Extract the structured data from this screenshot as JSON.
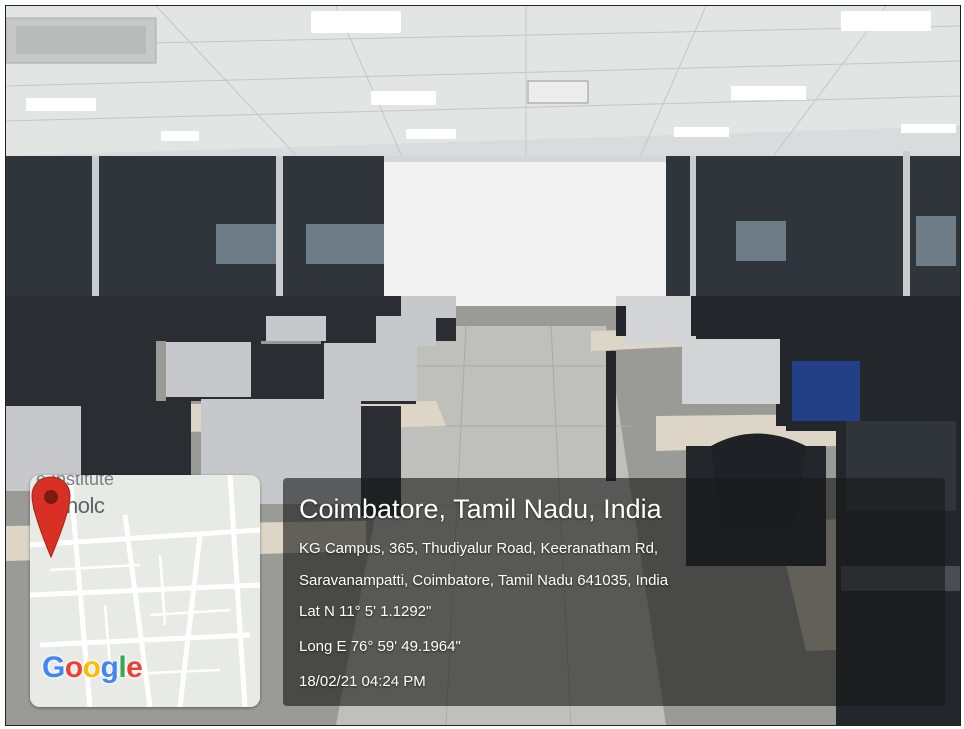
{
  "location": {
    "city_line": "Coimbatore, Tamil Nadu, India",
    "address_line1": "KG Campus, 365, Thudiyalur Road, Keeranatham Rd,",
    "address_line2": "Saravanampatti, Coimbatore, Tamil Nadu 641035, India",
    "latitude": "Lat N 11° 5' 1.1292\"",
    "longitude": "Long E 76° 59' 49.1964\"",
    "timestamp": "18/02/21 04:24 PM"
  },
  "map": {
    "place_label": "echnolc",
    "place_label_top": "e Institute",
    "logo_letters": [
      "G",
      "o",
      "o",
      "g",
      "l",
      "e"
    ],
    "pin_icon": "map-pin-icon",
    "poi_icon": "graduation-cap-icon",
    "colors": {
      "pin": "#d93025",
      "poi": "#7b8fa3"
    }
  }
}
